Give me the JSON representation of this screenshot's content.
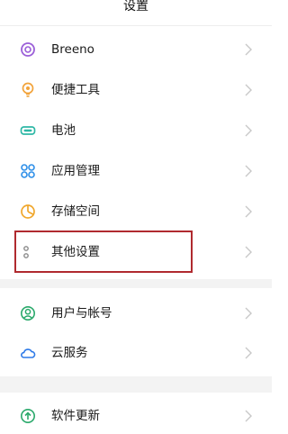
{
  "header": {
    "title": "设置"
  },
  "items": [
    {
      "label": "Breeno",
      "icon": "breeno-icon"
    },
    {
      "label": "便捷工具",
      "icon": "convenience-tools-icon"
    },
    {
      "label": "电池",
      "icon": "battery-icon"
    },
    {
      "label": "应用管理",
      "icon": "app-management-icon"
    },
    {
      "label": "存储空间",
      "icon": "storage-icon"
    },
    {
      "label": "其他设置",
      "icon": "other-settings-icon"
    },
    {
      "label": "用户与帐号",
      "icon": "users-accounts-icon"
    },
    {
      "label": "云服务",
      "icon": "cloud-service-icon"
    },
    {
      "label": "软件更新",
      "icon": "software-update-icon"
    }
  ],
  "colors": {
    "highlight": "#b02a2f",
    "breeno": "#9b5fd8",
    "tools": "#f2a33a",
    "battery": "#2fb8a6",
    "apps": "#2e8fe8",
    "storage": "#f0a72c",
    "other": "#8a8a8a",
    "users": "#2aa96b",
    "cloud": "#2e7ae8",
    "update": "#2aa96b"
  }
}
